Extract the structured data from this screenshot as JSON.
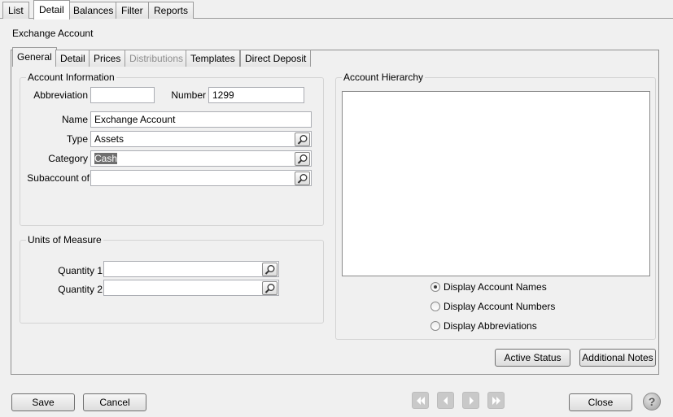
{
  "top_tabs": [
    "List",
    "Detail",
    "Balances",
    "Filter",
    "Reports"
  ],
  "page_title": "Exchange Account",
  "inner_tabs": [
    "General",
    "Detail",
    "Prices",
    "Distributions",
    "Templates",
    "Direct Deposit"
  ],
  "account_info": {
    "title": "Account Information",
    "abbreviation_label": "Abbreviation",
    "abbreviation_value": "",
    "number_label": "Number",
    "number_value": "1299",
    "name_label": "Name",
    "name_value": "Exchange Account",
    "type_label": "Type",
    "type_value": "Assets",
    "category_label": "Category",
    "category_value": "Cash",
    "subaccount_label": "Subaccount of",
    "subaccount_value": ""
  },
  "units": {
    "title": "Units of Measure",
    "quantity1_label": "Quantity 1",
    "quantity1_value": "",
    "quantity2_label": "Quantity 2",
    "quantity2_value": ""
  },
  "hierarchy": {
    "title": "Account Hierarchy",
    "options": [
      "Display Account Names",
      "Display Account Numbers",
      "Display Abbreviations"
    ],
    "selected": "Display Account Names"
  },
  "buttons": {
    "active_status": "Active Status",
    "additional_notes": "Additional Notes",
    "save": "Save",
    "cancel": "Cancel",
    "close": "Close",
    "help": "?"
  }
}
